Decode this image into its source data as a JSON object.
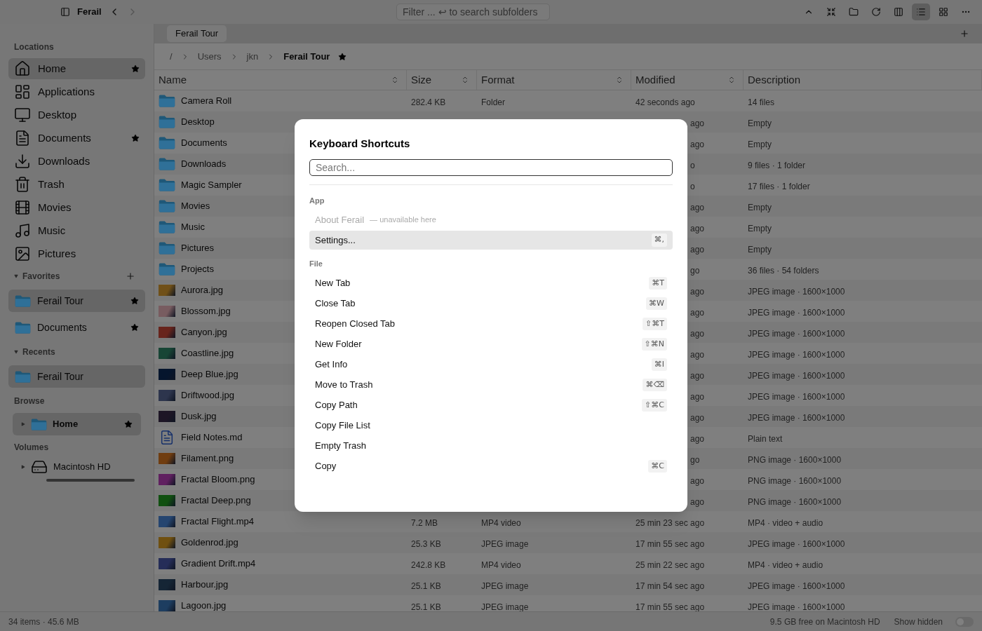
{
  "toolbar": {
    "title": "Ferail",
    "filter": {
      "placeholder": "Filter ... ↩ to search subfolders"
    },
    "buttons": [
      {
        "kind": "up"
      },
      {
        "kind": "collapse"
      },
      {
        "kind": "folder"
      },
      {
        "kind": "refresh"
      },
      {
        "kind": "panel"
      }
    ],
    "view_buttons": [
      {
        "kind": "list",
        "selected": true
      },
      {
        "kind": "grid",
        "selected": false
      }
    ]
  },
  "sidebar": {
    "locations": {
      "title": "Locations",
      "items": [
        {
          "label": "Home",
          "kind": "home",
          "starred": true,
          "selected": true
        },
        {
          "label": "Applications",
          "kind": "apps",
          "starred": false,
          "selected": false
        },
        {
          "label": "Desktop",
          "kind": "desktop",
          "starred": false,
          "selected": false
        },
        {
          "label": "Documents",
          "kind": "documents",
          "starred": true,
          "selected": false
        },
        {
          "label": "Downloads",
          "kind": "downloads",
          "starred": false,
          "selected": false
        },
        {
          "label": "Trash",
          "kind": "trash",
          "starred": false,
          "selected": false
        },
        {
          "label": "Movies",
          "kind": "movies",
          "starred": false,
          "selected": false
        },
        {
          "label": "Music",
          "kind": "music",
          "starred": false,
          "selected": false
        },
        {
          "label": "Pictures",
          "kind": "pictures",
          "starred": false,
          "selected": false
        }
      ]
    },
    "favorites": {
      "title": "Favorites",
      "expanded": true,
      "items": [
        {
          "label": "Ferail Tour",
          "starred": true,
          "selected": true
        },
        {
          "label": "Documents",
          "starred": true,
          "selected": false
        }
      ]
    },
    "recents": {
      "title": "Recents",
      "expanded": true,
      "items": [
        {
          "label": "Ferail Tour",
          "starred": false,
          "selected": true
        }
      ]
    },
    "browse": {
      "title": "Browse",
      "items": [
        {
          "label": "Home",
          "expanded": false,
          "starred": true,
          "selected": true
        }
      ]
    },
    "volumes": {
      "title": "Volumes",
      "items": [
        {
          "label": "Macintosh HD",
          "expanded": false
        }
      ]
    }
  },
  "tabs": [
    {
      "label": "Ferail Tour",
      "selected": true
    }
  ],
  "breadcrumb": [
    {
      "label": "/",
      "current": false,
      "starred": false
    },
    {
      "label": "Users",
      "current": false,
      "starred": false
    },
    {
      "label": "jkn",
      "current": false,
      "starred": false
    },
    {
      "label": "Ferail Tour",
      "current": true,
      "starred": true
    }
  ],
  "table": {
    "columns": [
      {
        "label": "Name",
        "sortable": true
      },
      {
        "label": "Size",
        "sortable": true
      },
      {
        "label": "Format",
        "sortable": true
      },
      {
        "label": "Modified",
        "sortable": true
      },
      {
        "label": "Description",
        "sortable": false
      }
    ],
    "rows": [
      {
        "name": "Camera Roll",
        "kind": "folder",
        "size": "282.4 KB",
        "format": "Folder",
        "modified": "42 seconds ago",
        "description": "14 files"
      },
      {
        "name": "Desktop",
        "kind": "folder",
        "modified": "ago",
        "description": "Empty"
      },
      {
        "name": "Documents",
        "kind": "folder",
        "modified": "ago",
        "description": "Empty"
      },
      {
        "name": "Downloads",
        "kind": "folder",
        "modified": "o",
        "description": "9 files · 1 folder"
      },
      {
        "name": "Magic Sampler",
        "kind": "folder",
        "modified": "o",
        "description": "17 files · 1 folder"
      },
      {
        "name": "Movies",
        "kind": "folder",
        "modified": "ago",
        "description": "Empty"
      },
      {
        "name": "Music",
        "kind": "folder",
        "modified": "ago",
        "description": "Empty"
      },
      {
        "name": "Pictures",
        "kind": "folder",
        "modified": "ago",
        "description": "Empty"
      },
      {
        "name": "Projects",
        "kind": "folder",
        "modified": "go",
        "description": "36 files · 54 folders"
      },
      {
        "name": "Aurora.jpg",
        "kind": "image",
        "color": "#705018",
        "modified": "ago",
        "description": "JPEG image · 1600×1000"
      },
      {
        "name": "Blossom.jpg",
        "kind": "image",
        "color": "#785c60",
        "modified": "ago",
        "description": "JPEG image · 1600×1000"
      },
      {
        "name": "Canyon.jpg",
        "kind": "image",
        "color": "#68241c",
        "modified": "ago",
        "description": "JPEG image · 1600×1000"
      },
      {
        "name": "Coastline.jpg",
        "kind": "image",
        "color": "#174535",
        "modified": "ago",
        "description": "JPEG image · 1600×1000"
      },
      {
        "name": "Deep Blue.jpg",
        "kind": "image",
        "color": "#05152d",
        "modified": "ago",
        "description": "JPEG image · 1600×1000"
      },
      {
        "name": "Driftwood.jpg",
        "kind": "image",
        "color": "#2d354d",
        "modified": "ago",
        "description": "JPEG image · 1600×1000"
      },
      {
        "name": "Dusk.jpg",
        "kind": "image",
        "color": "#1d1525",
        "modified": "ago",
        "description": "JPEG image · 1600×1000"
      },
      {
        "name": "Field Notes.md",
        "kind": "document",
        "modified": "ago",
        "description": "Plain text"
      },
      {
        "name": "Filament.png",
        "kind": "image",
        "color": "#703d10",
        "modified": "go",
        "description": "PNG image · 1600×1000"
      },
      {
        "name": "Fractal Bloom.png",
        "kind": "image",
        "color": "#602060",
        "modified": "ago",
        "description": "PNG image · 1600×1000"
      },
      {
        "name": "Fractal Deep.png",
        "kind": "image",
        "color": "#105010",
        "modified": "ago",
        "description": "PNG image · 1600×1000"
      },
      {
        "name": "Fractal Flight.mp4",
        "kind": "image",
        "color": "#254570",
        "size": "7.2 MB",
        "format": "MP4 video",
        "modified": "25 min 23 sec ago",
        "description": "MP4 · video + audio"
      },
      {
        "name": "Goldenrod.jpg",
        "kind": "image",
        "color": "#705010",
        "size": "25.3 KB",
        "format": "JPEG image",
        "modified": "17 min 55 sec ago",
        "description": "JPEG image · 1600×1000"
      },
      {
        "name": "Gradient Drift.mp4",
        "kind": "image",
        "color": "#252d58",
        "size": "242.8 KB",
        "format": "MP4 video",
        "modified": "25 min 22 sec ago",
        "description": "MP4 · video + audio"
      },
      {
        "name": "Harbour.jpg",
        "kind": "image",
        "color": "#152535",
        "size": "25.1 KB",
        "format": "JPEG image",
        "modified": "17 min 54 sec ago",
        "description": "JPEG image · 1600×1000"
      },
      {
        "name": "Lagoon.jpg",
        "kind": "image",
        "color": "#1d3d60",
        "size": "25.1 KB",
        "format": "JPEG image",
        "modified": "17 min 55 sec ago",
        "description": "JPEG image · 1600×1000"
      }
    ]
  },
  "status_bar": {
    "summary": "34 items · 45.6 MB",
    "free_space": "9.5 GB free on Macintosh HD",
    "show_hidden": {
      "label": "Show hidden",
      "on": false
    }
  },
  "dialog": {
    "title": "Keyboard Shortcuts",
    "search": {
      "placeholder": "Search..."
    },
    "groups": [
      {
        "title": "App",
        "items": [
          {
            "label": "About Ferail",
            "note": "— unavailable here",
            "disabled": true,
            "selected": false
          },
          {
            "label": "Settings...",
            "shortcut": "⌘,",
            "disabled": false,
            "selected": true
          }
        ]
      },
      {
        "title": "File",
        "items": [
          {
            "label": "New Tab",
            "shortcut": "⌘T",
            "disabled": false,
            "selected": false
          },
          {
            "label": "Close Tab",
            "shortcut": "⌘W",
            "disabled": false,
            "selected": false
          },
          {
            "label": "Reopen Closed Tab",
            "shortcut": "⇧⌘T",
            "disabled": false,
            "selected": false
          },
          {
            "label": "New Folder",
            "shortcut": "⇧⌘N",
            "disabled": false,
            "selected": false
          },
          {
            "label": "Get Info",
            "shortcut": "⌘I",
            "disabled": false,
            "selected": false
          },
          {
            "label": "Move to Trash",
            "shortcut": "⌘⌫",
            "disabled": false,
            "selected": false
          },
          {
            "label": "Copy Path",
            "shortcut": "⇧⌘C",
            "disabled": false,
            "selected": false
          },
          {
            "label": "Copy File List",
            "disabled": false,
            "selected": false
          },
          {
            "label": "Empty Trash",
            "disabled": false,
            "selected": false
          },
          {
            "label": "Copy",
            "shortcut": "⌘C",
            "disabled": false,
            "selected": false
          }
        ]
      }
    ]
  }
}
